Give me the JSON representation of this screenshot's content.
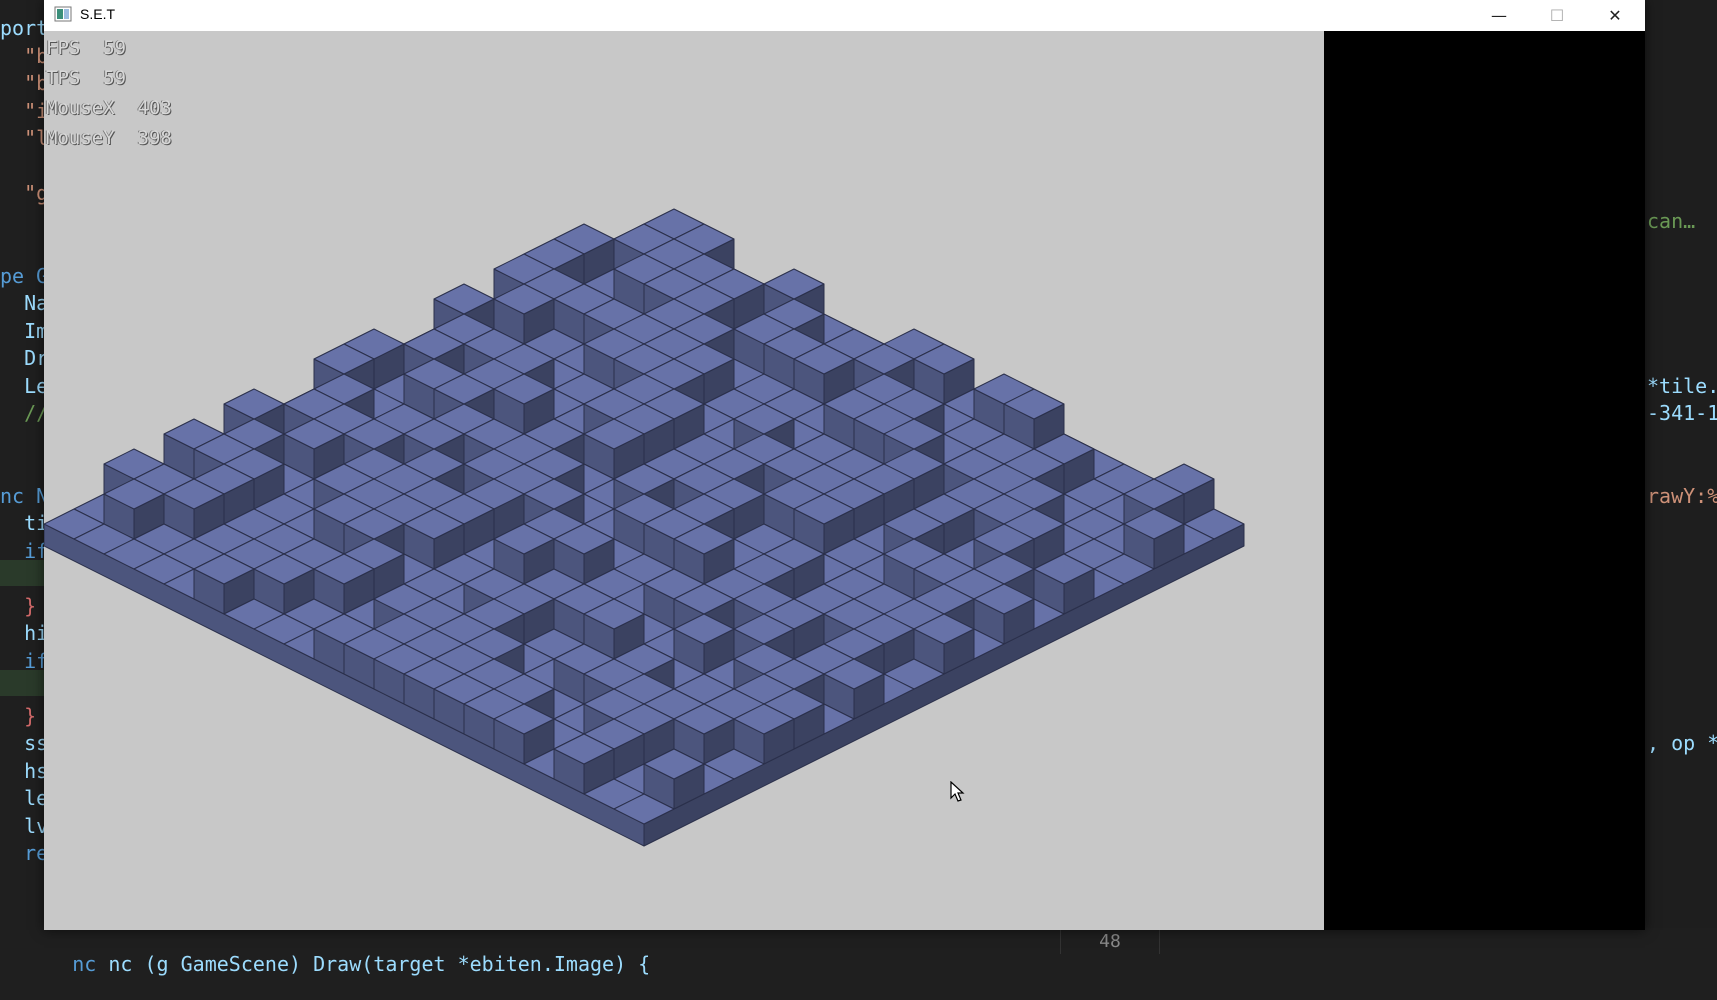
{
  "window": {
    "title": "S.E.T",
    "minimize_glyph": "—",
    "maximize_glyph": "☐",
    "close_glyph": "✕"
  },
  "hud": {
    "fps": "FPS  59",
    "tps": "TPS  59",
    "mouse_x": "MouseX  403",
    "mouse_y": "MouseY  398"
  },
  "game": {
    "background_color": "#c8c8c8",
    "tile_color": "#5f6a9c",
    "grid_size": 20
  },
  "editor": {
    "left_lines": [
      {
        "text": "port",
        "cls": "plain"
      },
      {
        "text": "  \"b",
        "cls": "str"
      },
      {
        "text": "  \"b",
        "cls": "str"
      },
      {
        "text": "  \"i",
        "cls": "str"
      },
      {
        "text": "  \"l",
        "cls": "str"
      },
      {
        "text": "",
        "cls": "plain"
      },
      {
        "text": "  \"g",
        "cls": "str"
      },
      {
        "text": "",
        "cls": "plain"
      },
      {
        "text": "",
        "cls": "plain"
      },
      {
        "text": "pe G",
        "cls": "kw"
      },
      {
        "text": "  Na",
        "cls": "plain"
      },
      {
        "text": "  Im",
        "cls": "plain"
      },
      {
        "text": "  Dr",
        "cls": "plain"
      },
      {
        "text": "  Le",
        "cls": "plain"
      },
      {
        "text": "  //",
        "cls": "cmt"
      },
      {
        "text": "",
        "cls": "plain"
      },
      {
        "text": "",
        "cls": "plain"
      },
      {
        "text": "nc N",
        "cls": "kw"
      },
      {
        "text": "  ti",
        "cls": "plain"
      },
      {
        "text": "  if",
        "cls": "kw"
      },
      {
        "text": "",
        "cls": "plain"
      },
      {
        "text": "  }",
        "cls": "brk"
      },
      {
        "text": "  hi",
        "cls": "plain"
      },
      {
        "text": "  if",
        "cls": "kw"
      },
      {
        "text": "",
        "cls": "plain"
      },
      {
        "text": "  }",
        "cls": "brk"
      },
      {
        "text": "  ss",
        "cls": "plain"
      },
      {
        "text": "  hs",
        "cls": "plain"
      },
      {
        "text": "  le",
        "cls": "plain"
      },
      {
        "text": "  lv",
        "cls": "plain"
      },
      {
        "text": "  re",
        "cls": "kw"
      }
    ],
    "right_lines": [
      {
        "text": "can…",
        "cls": "cmt",
        "row": 7
      },
      {
        "text": "*tile.",
        "cls": "plain",
        "row": 13
      },
      {
        "text": "-341-1",
        "cls": "plain",
        "row": 14
      },
      {
        "text": "rawY:%",
        "cls": "str",
        "row": 17
      },
      {
        "text": ", op *",
        "cls": "plain",
        "row": 26
      }
    ],
    "bottom_line": "nc (g GameScene) Draw(target *ebiten.Image) {",
    "status_line_number": "48"
  }
}
